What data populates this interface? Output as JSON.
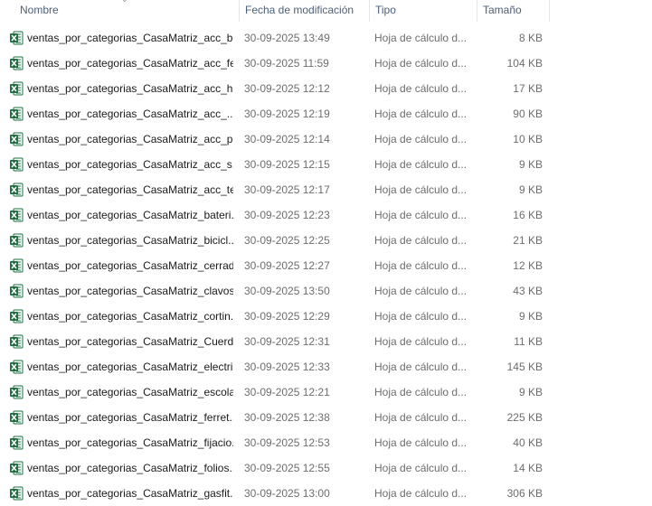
{
  "header": {
    "name_label": "Nombre",
    "date_label": "Fecha de modificación",
    "type_label": "Tipo",
    "size_label": "Tamaño"
  },
  "colors": {
    "excel_green": "#1d6f42",
    "header_text": "#4c607a",
    "secondary_text": "#6d6d6d"
  },
  "icon": "excel-file-icon",
  "files": [
    {
      "name": "ventas_por_categorias_CasaMatriz_acc_bi...",
      "date": "30-09-2025 13:49",
      "type": "Hoja de cálculo d...",
      "size": "8 KB"
    },
    {
      "name": "ventas_por_categorias_CasaMatriz_acc_fe...",
      "date": "30-09-2025 11:59",
      "type": "Hoja de cálculo d...",
      "size": "104 KB"
    },
    {
      "name": "ventas_por_categorias_CasaMatriz_acc_h...",
      "date": "30-09-2025 12:12",
      "type": "Hoja de cálculo d...",
      "size": "17 KB"
    },
    {
      "name": "ventas_por_categorias_CasaMatriz_acc_...",
      "date": "30-09-2025 12:19",
      "type": "Hoja de cálculo d...",
      "size": "90 KB"
    },
    {
      "name": "ventas_por_categorias_CasaMatriz_acc_p...",
      "date": "30-09-2025 12:14",
      "type": "Hoja de cálculo d...",
      "size": "10 KB"
    },
    {
      "name": "ventas_por_categorias_CasaMatriz_acc_s...",
      "date": "30-09-2025 12:15",
      "type": "Hoja de cálculo d...",
      "size": "9 KB"
    },
    {
      "name": "ventas_por_categorias_CasaMatriz_acc_te...",
      "date": "30-09-2025 12:17",
      "type": "Hoja de cálculo d...",
      "size": "9 KB"
    },
    {
      "name": "ventas_por_categorias_CasaMatriz_bateri...",
      "date": "30-09-2025 12:23",
      "type": "Hoja de cálculo d...",
      "size": "16 KB"
    },
    {
      "name": "ventas_por_categorias_CasaMatriz_bicicl...",
      "date": "30-09-2025 12:25",
      "type": "Hoja de cálculo d...",
      "size": "21 KB"
    },
    {
      "name": "ventas_por_categorias_CasaMatriz_cerrad...",
      "date": "30-09-2025 12:27",
      "type": "Hoja de cálculo d...",
      "size": "12 KB"
    },
    {
      "name": "ventas_por_categorias_CasaMatriz_clavos...",
      "date": "30-09-2025 13:50",
      "type": "Hoja de cálculo d...",
      "size": "43 KB"
    },
    {
      "name": "ventas_por_categorias_CasaMatriz_cortin...",
      "date": "30-09-2025 12:29",
      "type": "Hoja de cálculo d...",
      "size": "9 KB"
    },
    {
      "name": "ventas_por_categorias_CasaMatriz_Cuerd...",
      "date": "30-09-2025 12:31",
      "type": "Hoja de cálculo d...",
      "size": "11 KB"
    },
    {
      "name": "ventas_por_categorias_CasaMatriz_electri...",
      "date": "30-09-2025 12:33",
      "type": "Hoja de cálculo d...",
      "size": "145 KB"
    },
    {
      "name": "ventas_por_categorias_CasaMatriz_escola...",
      "date": "30-09-2025 12:21",
      "type": "Hoja de cálculo d...",
      "size": "9 KB"
    },
    {
      "name": "ventas_por_categorias_CasaMatriz_ferret...",
      "date": "30-09-2025 12:38",
      "type": "Hoja de cálculo d...",
      "size": "225 KB"
    },
    {
      "name": "ventas_por_categorias_CasaMatriz_fijacio...",
      "date": "30-09-2025 12:53",
      "type": "Hoja de cálculo d...",
      "size": "40 KB"
    },
    {
      "name": "ventas_por_categorias_CasaMatriz_folios....",
      "date": "30-09-2025 12:55",
      "type": "Hoja de cálculo d...",
      "size": "14 KB"
    },
    {
      "name": "ventas_por_categorias_CasaMatriz_gasfit...",
      "date": "30-09-2025 13:00",
      "type": "Hoja de cálculo d...",
      "size": "306 KB"
    }
  ]
}
